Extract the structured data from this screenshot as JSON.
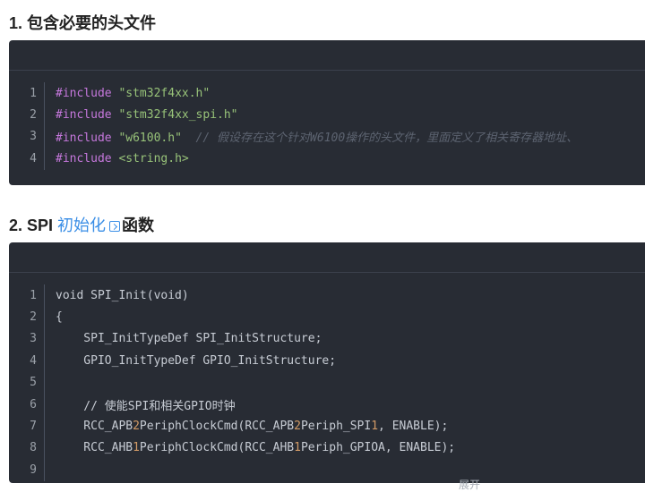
{
  "section1": {
    "heading": "1. 包含必要的头文件",
    "lines": [
      {
        "n": "1",
        "tokens": [
          {
            "t": "#include",
            "c": "kw"
          },
          {
            "t": " ",
            "c": ""
          },
          {
            "t": "\"stm32f4xx.h\"",
            "c": "str"
          }
        ]
      },
      {
        "n": "2",
        "tokens": [
          {
            "t": "#include",
            "c": "kw"
          },
          {
            "t": " ",
            "c": ""
          },
          {
            "t": "\"stm32f4xx_spi.h\"",
            "c": "str"
          }
        ]
      },
      {
        "n": "3",
        "tokens": [
          {
            "t": "#include",
            "c": "kw"
          },
          {
            "t": " ",
            "c": ""
          },
          {
            "t": "\"w6100.h\"",
            "c": "str"
          },
          {
            "t": "  // 假设存在这个针对W6100操作的头文件，里面定义了相关寄存器地址、",
            "c": "cm"
          }
        ]
      },
      {
        "n": "4",
        "tokens": [
          {
            "t": "#include",
            "c": "kw"
          },
          {
            "t": " ",
            "c": ""
          },
          {
            "t": "<string.h>",
            "c": "str"
          }
        ]
      }
    ]
  },
  "section2": {
    "heading_prefix": "2. SPI ",
    "heading_link": "初始化",
    "heading_suffix": "函数",
    "lines": [
      {
        "n": "1",
        "tokens": [
          {
            "t": "void SPI_Init(void)",
            "c": ""
          }
        ]
      },
      {
        "n": "2",
        "tokens": [
          {
            "t": "{",
            "c": ""
          }
        ]
      },
      {
        "n": "3",
        "tokens": [
          {
            "t": "    SPI_InitTypeDef SPI_InitStructure;",
            "c": ""
          }
        ]
      },
      {
        "n": "4",
        "tokens": [
          {
            "t": "    GPIO_InitTypeDef GPIO_InitStructure;",
            "c": ""
          }
        ]
      },
      {
        "n": "5",
        "tokens": [
          {
            "t": "",
            "c": ""
          }
        ]
      },
      {
        "n": "6",
        "tokens": [
          {
            "t": "    // 使能SPI和相关GPIO时钟",
            "c": ""
          }
        ]
      },
      {
        "n": "7",
        "tokens": [
          {
            "t": "    RCC_APB",
            "c": ""
          },
          {
            "t": "2",
            "c": "num"
          },
          {
            "t": "PeriphClockCmd(RCC_APB",
            "c": ""
          },
          {
            "t": "2",
            "c": "num"
          },
          {
            "t": "Periph_SPI",
            "c": ""
          },
          {
            "t": "1",
            "c": "num"
          },
          {
            "t": ", ENABLE);",
            "c": ""
          }
        ]
      },
      {
        "n": "8",
        "tokens": [
          {
            "t": "    RCC_AHB",
            "c": ""
          },
          {
            "t": "1",
            "c": "num"
          },
          {
            "t": "PeriphClockCmd(RCC_AHB",
            "c": ""
          },
          {
            "t": "1",
            "c": "num"
          },
          {
            "t": "Periph_GPIOA, ENABLE);",
            "c": ""
          }
        ]
      },
      {
        "n": "9",
        "tokens": [
          {
            "t": "",
            "c": ""
          }
        ]
      }
    ],
    "expand_label": "展开"
  }
}
